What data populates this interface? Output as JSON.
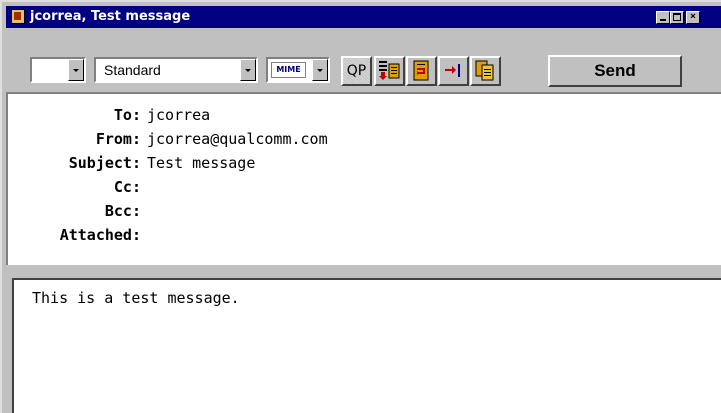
{
  "window": {
    "title": "jcorrea, Test message"
  },
  "toolbar": {
    "priority_value": "",
    "signature_value": "Standard",
    "encoding_label": "MIME",
    "qp_label": "QP",
    "send_label": "Send"
  },
  "header": {
    "to_label": "To:",
    "to_value": "jcorrea",
    "from_label": "From:",
    "from_value": "jcorrea@qualcomm.com",
    "subject_label": "Subject:",
    "subject_value": "Test message",
    "cc_label": "Cc:",
    "cc_value": "",
    "bcc_label": "Bcc:",
    "bcc_value": "",
    "attached_label": "Attached:",
    "attached_value": ""
  },
  "body": {
    "text": "This is a test message."
  }
}
